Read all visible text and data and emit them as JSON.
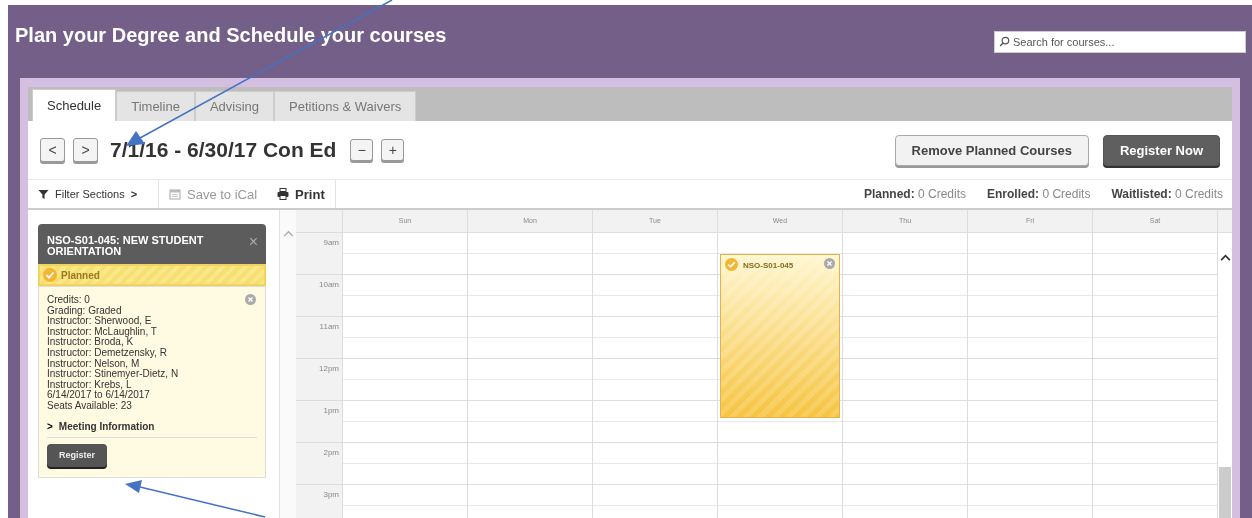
{
  "header": {
    "title": "Plan your Degree and Schedule your courses",
    "search": {
      "placeholder": "Search for courses..."
    }
  },
  "tabs": [
    {
      "label": "Schedule",
      "selected": true
    },
    {
      "label": "Timeline",
      "selected": false
    },
    {
      "label": "Advising",
      "selected": false
    },
    {
      "label": "Petitions & Waivers",
      "selected": false
    }
  ],
  "term": {
    "prev": "<",
    "next": ">",
    "title": "7/1/16 - 6/30/17 Con Ed",
    "zoom_out": "−",
    "zoom_in": "+"
  },
  "actions": [
    {
      "label": "Remove Planned Courses",
      "kind": "secondary"
    },
    {
      "label": "Register Now",
      "kind": "primary"
    }
  ],
  "toolbar": {
    "filter": "Filter Sections",
    "filter_caret": ">",
    "ical": {
      "label": "Save to iCal",
      "disabled": true
    },
    "print": {
      "label": "Print",
      "disabled": false
    }
  },
  "credits": [
    {
      "label": "Planned:",
      "value": "0 Credits"
    },
    {
      "label": "Enrolled:",
      "value": "0 Credits"
    },
    {
      "label": "Waitlisted:",
      "value": "0 Credits"
    }
  ],
  "course_card": {
    "title": "NSO-S01-045: NEW STUDENT ORIENTATION",
    "close": "×",
    "status": "Planned",
    "details": [
      "Credits: 0",
      "Grading: Graded",
      "Instructor: Sherwood, E",
      "Instructor: McLaughlin, T",
      "Instructor: Broda, K",
      "Instructor: Demetzensky, R",
      "Instructor: Nelson, M",
      "Instructor: Stinemyer-Dietz, N",
      "Instructor: Krebs, L",
      "6/14/2017 to 6/14/2017",
      "Seats Available:  23"
    ],
    "meeting_toggle": ">",
    "meeting": "Meeting Information",
    "expanded": false,
    "register": "Register"
  },
  "calendar": {
    "days": [
      {
        "label": "Sun"
      },
      {
        "label": "Mon"
      },
      {
        "label": "Tue"
      },
      {
        "label": "Wed",
        "event": "NSO-S01-045"
      },
      {
        "label": "Thu"
      },
      {
        "label": "Fri"
      },
      {
        "label": "Sat"
      }
    ],
    "times": [
      "9am",
      "10am",
      "11am",
      "12pm",
      "1pm",
      "2pm",
      "3pm"
    ]
  }
}
